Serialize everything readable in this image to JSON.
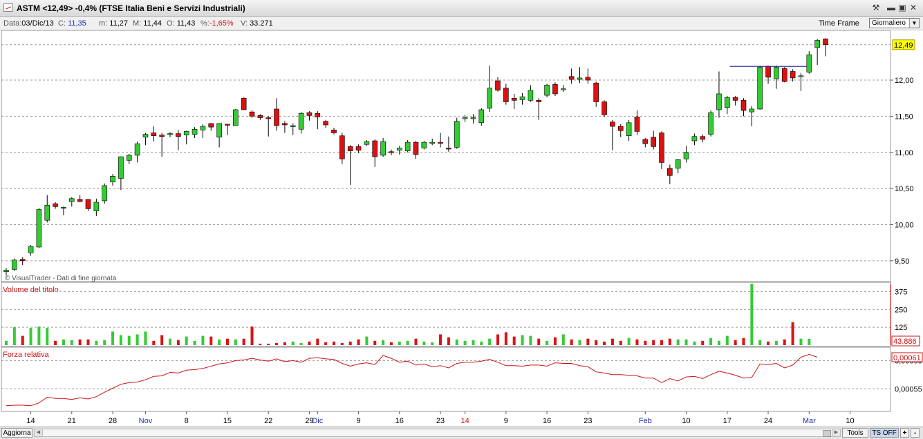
{
  "window": {
    "title": "ASTM <12,49> -0,4%  (FTSE Italia Beni e Servizi Industriali)",
    "buttons": [
      "⚒",
      "▬",
      "▣",
      "✕"
    ]
  },
  "info": {
    "data_label": "Data:",
    "data_value": "03/Dic/13",
    "c_label": "C:",
    "c_value": "11,35",
    "m_label": "m:",
    "m_value": "11,27",
    "M_label": "M:",
    "M_value": "11,44",
    "o_label": "O:",
    "o_value": "11,43",
    "pct_label": "%:",
    "pct_value": "-1,65%",
    "v_label": "V:",
    "v_value": "33.271",
    "time_frame_label": "Time Frame",
    "time_frame_value": "Giornaliero"
  },
  "colors": {
    "up": "#33cc33",
    "down": "#dd1111",
    "axis_blue": "#1f2fb8",
    "axis_red": "#d01010",
    "last_price_bg": "#ffff00"
  },
  "bottom": {
    "update_label": "Aggiorna",
    "tools_label": "Tools",
    "ts_label": "TS OFF",
    "plus": "+",
    "minus": "-"
  },
  "chart_data": [
    {
      "type": "candlestick",
      "title": "",
      "watermark": "© VisualTrader - Dati di fine giornata",
      "ylim": [
        9.25,
        12.65
      ],
      "y_ticks": [
        "9,50",
        "10,00",
        "10,50",
        "11,00",
        "11,50",
        "12,00"
      ],
      "last_price_label": "12,49",
      "resistance_line": {
        "from_day": 89,
        "to_day": 97,
        "value": 12.19
      },
      "x_labels": [
        {
          "day": 3,
          "text": "14",
          "color": "black"
        },
        {
          "day": 8,
          "text": "21",
          "color": "black"
        },
        {
          "day": 13,
          "text": "28",
          "color": "black"
        },
        {
          "day": 17,
          "text": "Nov",
          "color": "blue"
        },
        {
          "day": 22,
          "text": "8",
          "color": "black"
        },
        {
          "day": 27,
          "text": "15",
          "color": "black"
        },
        {
          "day": 32,
          "text": "22",
          "color": "black"
        },
        {
          "day": 37,
          "text": "29",
          "color": "black"
        },
        {
          "day": 38,
          "text": "Dic",
          "color": "blue"
        },
        {
          "day": 43,
          "text": "9",
          "color": "black"
        },
        {
          "day": 48,
          "text": "16",
          "color": "black"
        },
        {
          "day": 53,
          "text": "23",
          "color": "black"
        },
        {
          "day": 56,
          "text": "14",
          "color": "red"
        },
        {
          "day": 61,
          "text": "9",
          "color": "black"
        },
        {
          "day": 66,
          "text": "16",
          "color": "black"
        },
        {
          "day": 71,
          "text": "23",
          "color": "black"
        },
        {
          "day": 78,
          "text": "Feb",
          "color": "blue"
        },
        {
          "day": 83,
          "text": "10",
          "color": "black"
        },
        {
          "day": 88,
          "text": "17",
          "color": "black"
        },
        {
          "day": 93,
          "text": "24",
          "color": "black"
        },
        {
          "day": 98,
          "text": "Mar",
          "color": "blue"
        },
        {
          "day": 103,
          "text": "10",
          "color": "black"
        }
      ],
      "candles": [
        [
          9.35,
          9.37,
          9.3,
          9.4
        ],
        [
          9.38,
          9.51,
          9.36,
          9.53
        ],
        [
          9.52,
          9.5,
          9.44,
          9.55
        ],
        [
          9.61,
          9.7,
          9.57,
          9.72
        ],
        [
          9.69,
          10.21,
          9.68,
          10.23
        ],
        [
          10.06,
          10.27,
          10.03,
          10.41
        ],
        [
          10.29,
          10.25,
          10.22,
          10.31
        ],
        [
          10.24,
          10.24,
          10.13,
          10.25
        ],
        [
          10.32,
          10.36,
          10.25,
          10.38
        ],
        [
          10.35,
          10.32,
          10.31,
          10.41
        ],
        [
          10.35,
          10.22,
          10.19,
          10.35
        ],
        [
          10.19,
          10.31,
          10.12,
          10.36
        ],
        [
          10.33,
          10.54,
          10.29,
          10.57
        ],
        [
          10.59,
          10.67,
          10.54,
          10.7
        ],
        [
          10.64,
          10.94,
          10.48,
          10.94
        ],
        [
          10.89,
          10.96,
          10.84,
          10.98
        ],
        [
          10.96,
          11.12,
          10.86,
          11.15
        ],
        [
          11.21,
          11.25,
          11.1,
          11.27
        ],
        [
          11.27,
          11.23,
          11.15,
          11.36
        ],
        [
          11.24,
          11.22,
          10.94,
          11.27
        ],
        [
          11.25,
          11.26,
          11.21,
          11.28
        ],
        [
          11.26,
          11.22,
          11.03,
          11.31
        ],
        [
          11.24,
          11.29,
          11.11,
          11.3
        ],
        [
          11.25,
          11.32,
          11.2,
          11.35
        ],
        [
          11.31,
          11.36,
          11.2,
          11.39
        ],
        [
          11.4,
          11.35,
          11.3,
          11.4
        ],
        [
          11.21,
          11.4,
          11.07,
          11.4
        ],
        [
          11.39,
          11.38,
          11.24,
          11.39
        ],
        [
          11.37,
          11.59,
          11.37,
          11.6
        ],
        [
          11.75,
          11.59,
          11.59,
          11.76
        ],
        [
          11.56,
          11.5,
          11.48,
          11.58
        ],
        [
          11.51,
          11.48,
          11.45,
          11.53
        ],
        [
          11.48,
          11.47,
          11.22,
          11.5
        ],
        [
          11.6,
          11.37,
          11.3,
          11.75
        ],
        [
          11.4,
          11.38,
          11.27,
          11.43
        ],
        [
          11.37,
          11.37,
          11.24,
          11.4
        ],
        [
          11.32,
          11.54,
          11.26,
          11.56
        ],
        [
          11.55,
          11.51,
          11.44,
          11.57
        ],
        [
          11.54,
          11.49,
          11.32,
          11.57
        ],
        [
          11.43,
          11.38,
          11.34,
          11.45
        ],
        [
          11.31,
          11.27,
          11.25,
          11.34
        ],
        [
          11.23,
          10.91,
          10.84,
          11.27
        ],
        [
          11.08,
          11.02,
          10.55,
          11.1
        ],
        [
          11.08,
          11.03,
          10.99,
          11.11
        ],
        [
          11.11,
          11.15,
          11.09,
          11.17
        ],
        [
          11.16,
          10.94,
          10.8,
          11.18
        ],
        [
          10.96,
          11.15,
          10.94,
          11.2
        ],
        [
          11.01,
          11.0,
          10.96,
          11.04
        ],
        [
          11.03,
          11.06,
          10.97,
          11.09
        ],
        [
          11.02,
          11.14,
          11.0,
          11.17
        ],
        [
          11.14,
          10.97,
          10.91,
          11.16
        ],
        [
          11.06,
          11.14,
          11.04,
          11.16
        ],
        [
          11.14,
          11.14,
          11.1,
          11.19
        ],
        [
          11.14,
          11.13,
          11.07,
          11.27
        ],
        [
          11.06,
          11.05,
          11.01,
          11.22
        ],
        [
          11.07,
          11.43,
          11.05,
          11.48
        ],
        [
          11.47,
          11.48,
          11.42,
          11.52
        ],
        [
          11.48,
          11.48,
          11.4,
          11.53
        ],
        [
          11.41,
          11.59,
          11.37,
          11.61
        ],
        [
          11.61,
          11.89,
          11.56,
          12.2
        ],
        [
          11.99,
          11.86,
          11.84,
          12.04
        ],
        [
          11.89,
          11.7,
          11.66,
          11.95
        ],
        [
          11.75,
          11.72,
          11.6,
          11.81
        ],
        [
          11.73,
          11.77,
          11.66,
          11.82
        ],
        [
          11.72,
          11.86,
          11.7,
          11.93
        ],
        [
          11.72,
          11.7,
          11.45,
          11.75
        ],
        [
          11.79,
          11.93,
          11.76,
          11.95
        ],
        [
          11.94,
          11.81,
          11.78,
          11.97
        ],
        [
          11.87,
          11.88,
          11.84,
          11.93
        ],
        [
          12.05,
          12.01,
          11.95,
          12.16
        ],
        [
          12.01,
          12.03,
          11.96,
          12.18
        ],
        [
          12.04,
          12.0,
          11.95,
          12.16
        ],
        [
          11.96,
          11.7,
          11.63,
          11.98
        ],
        [
          11.7,
          11.52,
          11.49,
          11.72
        ],
        [
          11.42,
          11.36,
          11.03,
          11.45
        ],
        [
          11.36,
          11.3,
          11.21,
          11.39
        ],
        [
          11.23,
          11.41,
          11.16,
          11.45
        ],
        [
          11.49,
          11.29,
          11.24,
          11.58
        ],
        [
          11.18,
          11.12,
          11.07,
          11.2
        ],
        [
          11.21,
          11.08,
          11.04,
          11.3
        ],
        [
          11.27,
          10.86,
          10.77,
          11.29
        ],
        [
          10.78,
          10.68,
          10.56,
          10.83
        ],
        [
          10.78,
          10.9,
          10.71,
          10.91
        ],
        [
          10.91,
          11.0,
          10.86,
          11.09
        ],
        [
          11.16,
          11.22,
          11.1,
          11.26
        ],
        [
          11.22,
          11.18,
          11.14,
          11.25
        ],
        [
          11.25,
          11.55,
          11.22,
          11.58
        ],
        [
          11.59,
          11.81,
          11.48,
          12.12
        ],
        [
          11.62,
          11.76,
          11.53,
          11.78
        ],
        [
          11.76,
          11.72,
          11.65,
          11.78
        ],
        [
          11.72,
          11.58,
          11.5,
          11.75
        ],
        [
          11.56,
          11.6,
          11.36,
          11.64
        ],
        [
          11.6,
          12.18,
          11.59,
          12.2
        ],
        [
          12.19,
          12.04,
          11.95,
          12.2
        ],
        [
          12.02,
          12.18,
          11.88,
          12.2
        ],
        [
          12.16,
          11.98,
          11.97,
          12.18
        ],
        [
          12.12,
          12.03,
          11.98,
          12.15
        ],
        [
          12.05,
          12.06,
          11.85,
          12.1
        ],
        [
          12.11,
          12.35,
          12.09,
          12.4
        ],
        [
          12.45,
          12.55,
          12.21,
          12.57
        ],
        [
          12.57,
          12.49,
          12.33,
          12.58
        ]
      ]
    },
    {
      "type": "bar",
      "title": "Volume del titolo",
      "ylim": [
        0,
        430
      ],
      "y_ticks": [
        "125",
        "250",
        "375"
      ],
      "last_label": "43.886",
      "values": [
        30,
        125,
        65,
        120,
        130,
        120,
        30,
        40,
        35,
        40,
        40,
        30,
        35,
        95,
        70,
        65,
        75,
        95,
        30,
        70,
        45,
        35,
        60,
        30,
        65,
        60,
        40,
        45,
        40,
        45,
        130,
        10,
        10,
        15,
        20,
        25,
        15,
        25,
        45,
        20,
        25,
        15,
        25,
        40,
        60,
        30,
        35,
        20,
        25,
        30,
        45,
        25,
        20,
        75,
        55,
        40,
        30,
        35,
        25,
        45,
        75,
        90,
        60,
        70,
        65,
        45,
        30,
        55,
        75,
        40,
        35,
        45,
        35,
        25,
        45,
        30,
        50,
        40,
        30,
        35,
        35,
        45,
        40,
        40,
        25,
        30,
        50,
        30,
        65,
        35,
        50,
        430,
        35,
        25,
        30,
        40,
        160,
        45,
        44
      ]
    },
    {
      "type": "line",
      "title": "Forza relativa",
      "ylim": [
        0.00051,
        0.00062
      ],
      "y_ticks": [
        "0,00055",
        "0,00060"
      ],
      "last_label": "0,00061",
      "values": [
        0.00052,
        0.000521,
        0.000521,
        0.00052,
        0.000525,
        0.000535,
        0.000533,
        0.000533,
        0.000531,
        0.000534,
        0.000532,
        0.000536,
        0.000544,
        0.000551,
        0.000558,
        0.000561,
        0.000562,
        0.000566,
        0.000572,
        0.000573,
        0.000579,
        0.000578,
        0.000583,
        0.000584,
        0.000586,
        0.00059,
        0.000594,
        0.000596,
        0.0006,
        0.000601,
        0.000604,
        0.000601,
        0.000599,
        0.000603,
        0.000598,
        0.0006,
        0.000597,
        0.000604,
        0.000605,
        0.000603,
        0.000602,
        0.000595,
        0.00059,
        0.000594,
        0.000596,
        0.000593,
        0.000609,
        0.000604,
        0.000597,
        0.000599,
        0.000592,
        0.000594,
        0.000589,
        0.000591,
        0.000587,
        0.000595,
        0.000597,
        0.000597,
        0.000599,
        0.000602,
        0.000597,
        0.000591,
        0.000591,
        0.00059,
        0.000592,
        0.000592,
        0.00059,
        0.000596,
        0.000595,
        0.000595,
        0.000591,
        0.000589,
        0.00058,
        0.000578,
        0.000575,
        0.000575,
        0.000574,
        0.000573,
        0.000569,
        0.000569,
        0.000561,
        0.000568,
        0.000564,
        0.000571,
        0.000572,
        0.000568,
        0.000575,
        0.000581,
        0.000578,
        0.000574,
        0.000569,
        0.00057,
        0.000594,
        0.000593,
        0.000595,
        0.000587,
        0.000592,
        0.000606,
        0.000611,
        0.000606
      ]
    }
  ]
}
